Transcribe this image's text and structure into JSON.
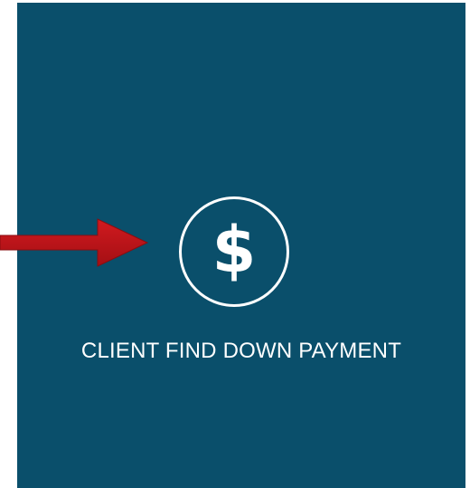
{
  "tile": {
    "label": "CLIENT FIND DOWN PAYMENT",
    "icon": "dollar-icon",
    "icon_glyph": "$",
    "background_color": "#0a4f6b"
  },
  "annotation": {
    "icon": "red-arrow-pointer",
    "color": "#c0161c"
  }
}
